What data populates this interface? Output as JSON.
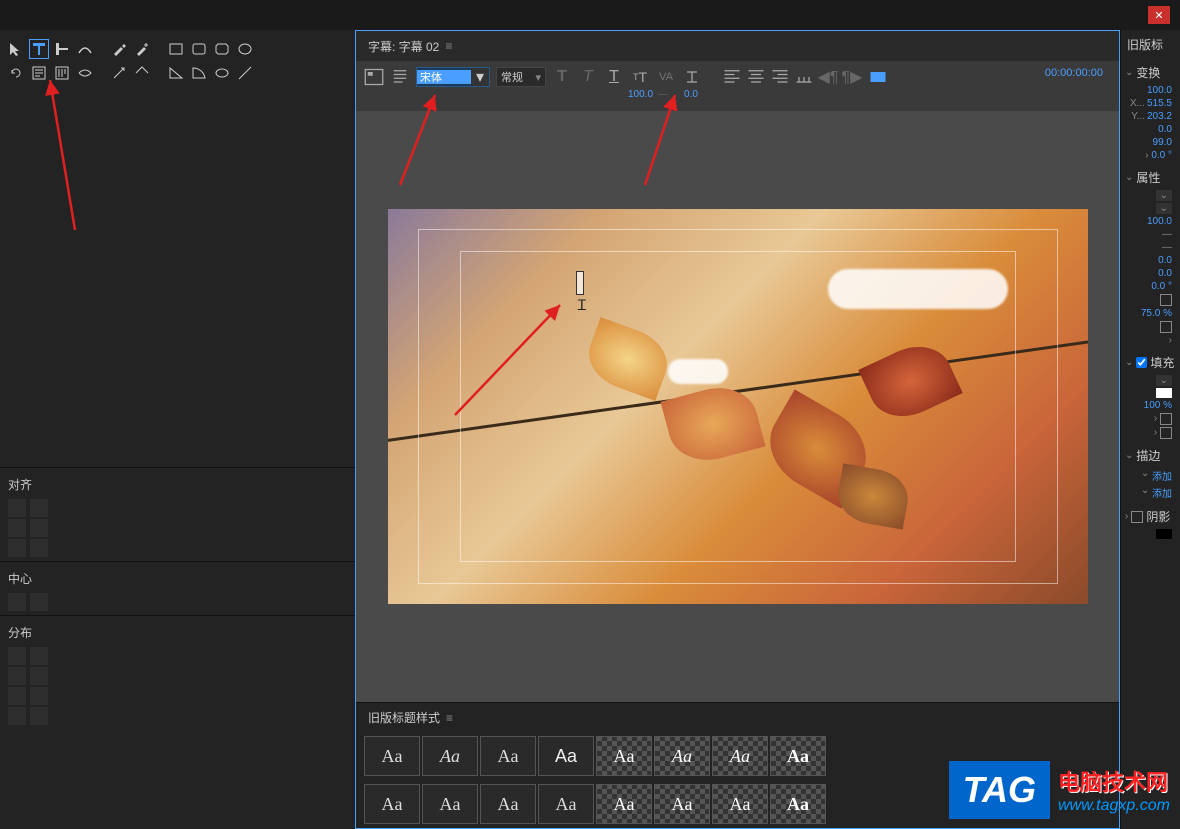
{
  "window": {
    "close": "✕"
  },
  "title_panel": {
    "label": "字幕: 字幕 02",
    "menu": "≡"
  },
  "toolbar": {
    "font_value": "宋体",
    "style_value": "常规",
    "size_value": "100.0",
    "tracking_value": "—",
    "leading_value": "0.0",
    "timecode": "00:00:00:00"
  },
  "left_panels": {
    "align": "对齐",
    "center": "中心",
    "distribute": "分布"
  },
  "styles_panel": {
    "title": "旧版标题样式",
    "menu": "≡",
    "swatch_text": "Aa"
  },
  "right_panel": {
    "header": "旧版标",
    "transform": {
      "title": "变换",
      "opacity": "100.0",
      "x_label": "X...",
      "x_value": "515.5",
      "y_label": "Y...",
      "y_value": "203.2",
      "w": "0.0",
      "h": "99.0",
      "rot": "0.0 °"
    },
    "properties": {
      "title": "属性",
      "v1": "100.0",
      "v2": "—",
      "v3": "—",
      "v4": "0.0",
      "v5": "0.0",
      "v6": "0.0 °",
      "v7": "75.0 %"
    },
    "fill": {
      "title": "填充",
      "pct": "100 %"
    },
    "stroke": {
      "title": "描边",
      "add1": "添加",
      "add2": "添加"
    },
    "shadow": {
      "title": "阴影"
    }
  },
  "watermark": {
    "logo": "TAG",
    "text": "电脑技术网",
    "url": "www.tagxp.com"
  }
}
